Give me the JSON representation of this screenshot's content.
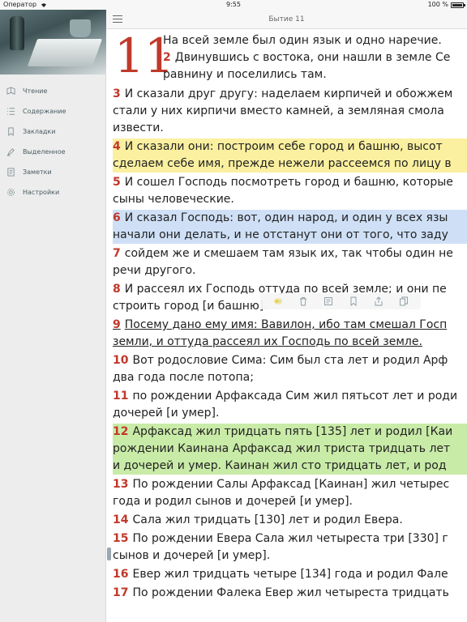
{
  "status": {
    "carrier": "Оператор",
    "time": "9:55",
    "battery": "100 %"
  },
  "sidebar": {
    "items": [
      {
        "label": "Чтение",
        "icon": "reading-icon"
      },
      {
        "label": "Содержание",
        "icon": "contents-icon"
      },
      {
        "label": "Закладки",
        "icon": "bookmark-icon"
      },
      {
        "label": "Выделенное",
        "icon": "highlighter-icon"
      },
      {
        "label": "Заметки",
        "icon": "notes-icon"
      },
      {
        "label": "Настройки",
        "icon": "settings-icon"
      }
    ]
  },
  "header": {
    "title": "Бытие 11"
  },
  "reader": {
    "chapter": "11",
    "first_verse_lines": [
      "На всей земле был один язык и одно наречие."
    ],
    "verses": [
      {
        "num": "2",
        "lines": [
          "Двинувшись с востока, они нашли в земле Се",
          "равнину и поселились там."
        ],
        "hl": "",
        "inline_with_cap": true
      },
      {
        "num": "3",
        "lines": [
          "И сказали друг другу: наделаем кирпичей и обожжем",
          "стали у них кирпичи вместо камней, а земляная смола",
          "извести."
        ],
        "hl": ""
      },
      {
        "num": "4",
        "lines": [
          "И сказали они: построим себе город и башню, высот",
          "сделаем себе имя, прежде нежели рассеемся по лицу в"
        ],
        "hl": "yellow"
      },
      {
        "num": "5",
        "lines": [
          "И сошел Господь посмотреть город и башню, которые",
          "сыны человеческие."
        ],
        "hl": ""
      },
      {
        "num": "6",
        "lines": [
          "И сказал Господь: вот, один народ, и один у всех язы",
          "начали они делать, и не отстанут они от того, что заду"
        ],
        "hl": "blue"
      },
      {
        "num": "7",
        "lines": [
          "сойдем же и смешаем там язык их, так чтобы один не",
          "речи другого."
        ],
        "hl": ""
      },
      {
        "num": "8",
        "lines": [
          "И рассеял их Господь оттуда по всей земле; и они пе",
          "строить город [и башню]."
        ],
        "hl": ""
      },
      {
        "num": "9",
        "lines": [
          "Посему дано ему имя: Вавилон, ибо там смешал Госп",
          "земли, и оттуда рассеял их Господь по всей земле."
        ],
        "hl": "underline"
      },
      {
        "num": "10",
        "lines": [
          "Вот родословие Сима: Сим был ста лет и родил Арф",
          "два года после потопа;"
        ],
        "hl": ""
      },
      {
        "num": "11",
        "lines": [
          "по рождении Арфаксада Сим жил пятьсот лет и роди",
          "дочерей [и умер]."
        ],
        "hl": ""
      },
      {
        "num": "12",
        "lines": [
          "Арфаксад жил тридцать пять [135] лет и родил [Каи",
          "рождении Каинана Арфаксад жил триста тридцать лет",
          "и дочерей и умер. Каинан жил сто тридцать лет, и род"
        ],
        "hl": "green"
      },
      {
        "num": "13",
        "lines": [
          "По рождении Салы Арфаксад [Каинан] жил четырес",
          "года и родил сынов и дочерей [и умер]."
        ],
        "hl": ""
      },
      {
        "num": "14",
        "lines": [
          "Сала жил тридцать [130] лет и родил Евера."
        ],
        "hl": ""
      },
      {
        "num": "15",
        "lines": [
          "По рождении Евера Сала жил четыреста три [330] г",
          "сынов и дочерей [и умер]."
        ],
        "hl": ""
      },
      {
        "num": "16",
        "lines": [
          "Евер жил тридцать четыре [134] года и родил Фале"
        ],
        "hl": ""
      },
      {
        "num": "17",
        "lines": [
          "По рождении Фалека Евер жил четыреста тридцать"
        ],
        "hl": ""
      }
    ]
  },
  "toolbar": {
    "buttons": [
      "color-picker-icon",
      "trash-icon",
      "note-icon",
      "bookmark-icon",
      "share-icon",
      "copy-icon"
    ]
  }
}
